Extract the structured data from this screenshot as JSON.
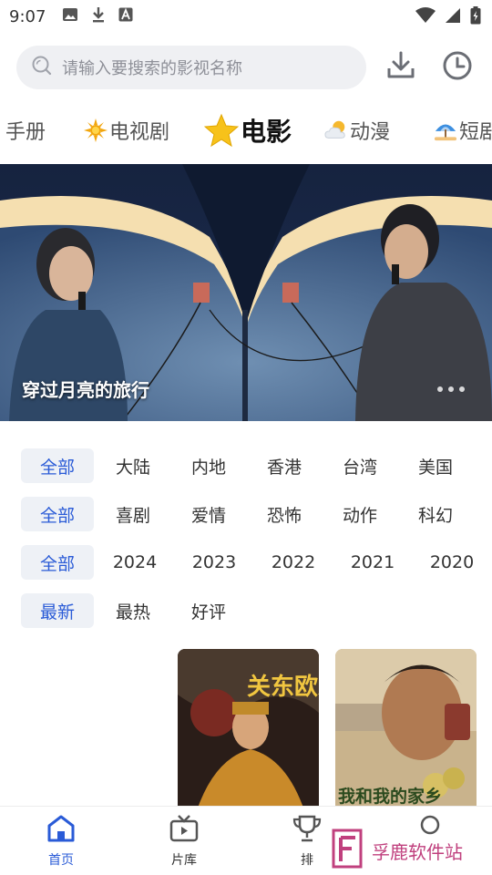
{
  "status_bar": {
    "time": "9:07",
    "left_icons": [
      "image-icon",
      "download-icon",
      "app-a-icon"
    ],
    "right_icons": [
      "wifi-icon",
      "signal-icon",
      "battery-icon"
    ]
  },
  "search": {
    "placeholder": "请输入要搜索的影视名称",
    "download_icon": "download-icon",
    "history_icon": "clock-icon"
  },
  "tabs": [
    {
      "label": "手册",
      "icon": null,
      "active": false
    },
    {
      "label": "电视剧",
      "icon": "sun-icon",
      "active": false
    },
    {
      "label": "电影",
      "icon": "star-icon",
      "active": true
    },
    {
      "label": "动漫",
      "icon": "cloud-sun-icon",
      "active": false
    },
    {
      "label": "短剧",
      "icon": "umbrella-icon",
      "active": false
    }
  ],
  "banner": {
    "title": "穿过月亮的旅行",
    "dots": 3
  },
  "filters": {
    "region": [
      "全部",
      "大陆",
      "内地",
      "香港",
      "台湾",
      "美国"
    ],
    "genre": [
      "全部",
      "喜剧",
      "爱情",
      "恐怖",
      "动作",
      "科幻"
    ],
    "year": [
      "全部",
      "2024",
      "2023",
      "2022",
      "2021",
      "2020"
    ],
    "sort": [
      "最新",
      "最热",
      "好评"
    ]
  },
  "posters": [
    {
      "title_art": "关东欧来"
    },
    {
      "title_art": "我和我的家乡"
    }
  ],
  "bottom_nav": [
    {
      "label": "首页",
      "icon": "home-icon",
      "active": true
    },
    {
      "label": "片库",
      "icon": "tv-icon",
      "active": false
    },
    {
      "label": "排",
      "icon": "trophy-icon",
      "active": false
    },
    {
      "label": "",
      "icon": "profile-icon",
      "active": false
    }
  ],
  "watermark": {
    "text": "孚鹿软件站"
  },
  "colors": {
    "accent": "#2a5bd7",
    "chip_bg": "#eef1f6",
    "search_bg": "#eff0f3"
  }
}
